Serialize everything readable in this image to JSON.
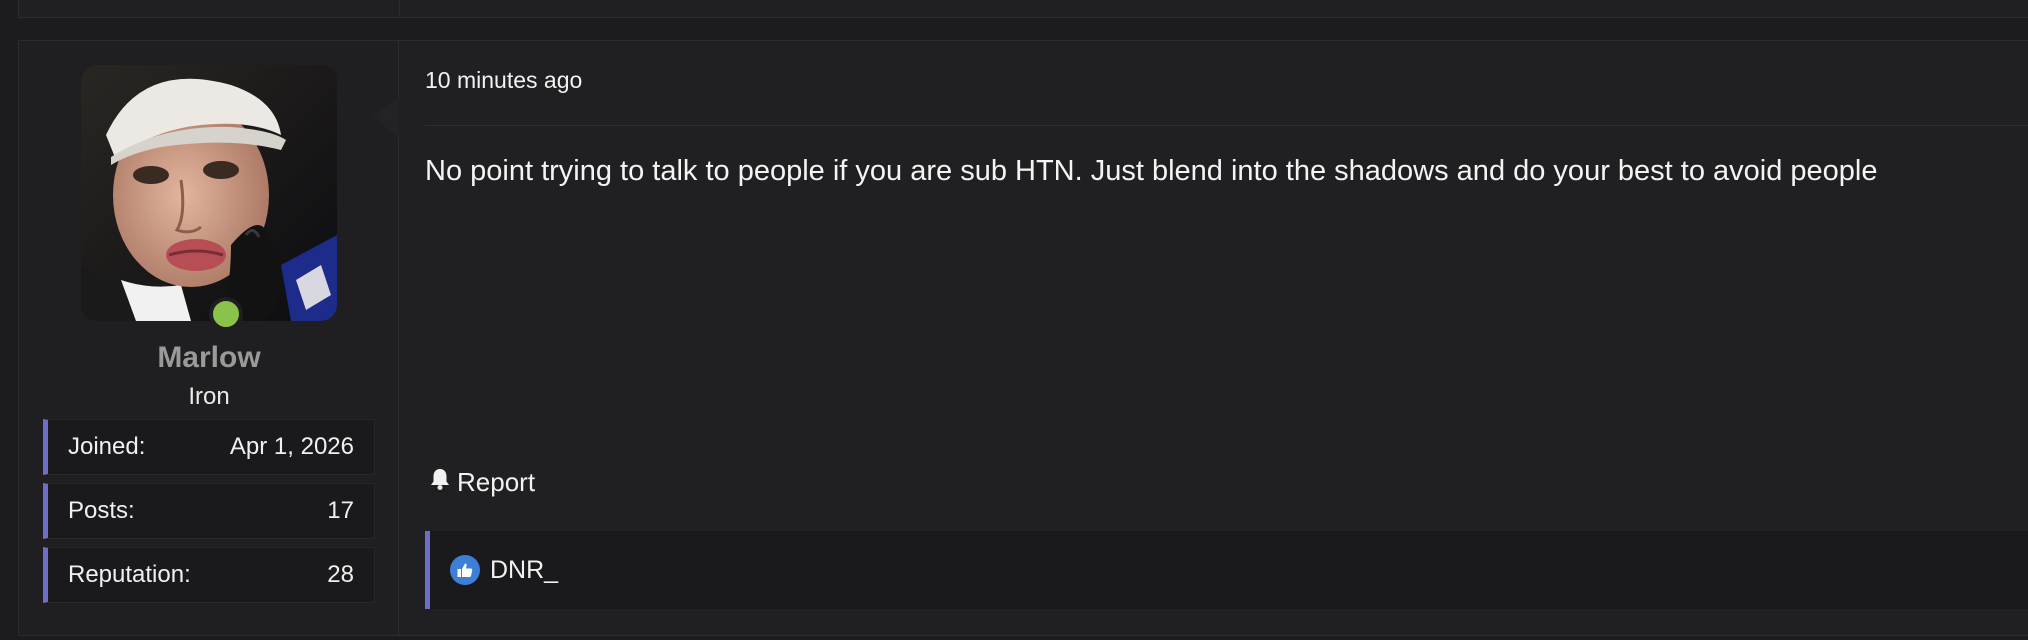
{
  "author": {
    "username": "Marlow",
    "rank": "Iron",
    "online": true,
    "online_color": "#8bc34a",
    "stats": [
      {
        "label": "Joined:",
        "value": "Apr 1, 2026"
      },
      {
        "label": "Posts:",
        "value": "17"
      },
      {
        "label": "Reputation:",
        "value": "28"
      }
    ]
  },
  "post": {
    "timestamp": "10 minutes ago",
    "message": "No point trying to talk to people if you are sub HTN. Just blend into the shadows and do your best to avoid people",
    "report_label": "Report",
    "report_icon": "bell-icon"
  },
  "reactions": {
    "icon": "thumbs-up-icon",
    "users": "DNR_"
  },
  "colors": {
    "accent": "#6b6fc7",
    "background": "#1c1c1e",
    "panel": "#202022",
    "like": "#3d7fd6"
  }
}
